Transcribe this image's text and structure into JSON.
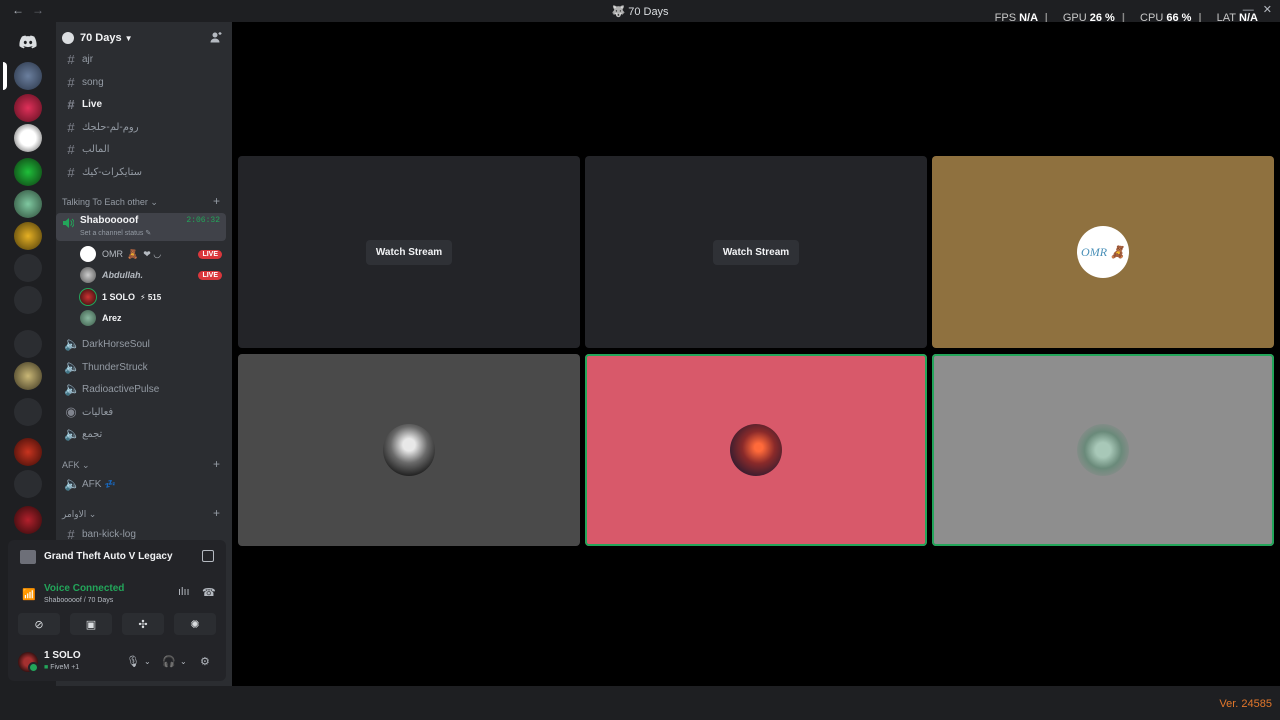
{
  "window": {
    "title": "70 Days"
  },
  "overlay": {
    "fps_label": "FPS",
    "fps_value": "N/A",
    "gpu_label": "GPU",
    "gpu_value": "26 %",
    "cpu_label": "CPU",
    "cpu_value": "66 %",
    "lat_label": "LAT",
    "lat_value": "N/A"
  },
  "guild": {
    "name": "70 Days"
  },
  "channels": {
    "text": [
      {
        "label": "ajr"
      },
      {
        "label": "song"
      },
      {
        "label": "Live"
      },
      {
        "label": "روم-لم-حلجك"
      },
      {
        "label": "المالب"
      },
      {
        "label": "ستايكرات-كيك"
      }
    ],
    "category_talking": "Talking To Each other",
    "voice_active": {
      "name": "Shabooooof",
      "status": "Set a channel status",
      "timer": "2:06:32"
    },
    "members": [
      {
        "name": "OMR",
        "live": "LIVE",
        "color": "#b5bac1"
      },
      {
        "name": "Abdullah.",
        "live": "LIVE",
        "color": "#b5bac1"
      },
      {
        "name": "1 SOLO",
        "extra": "⚡ 515",
        "color": "#f2f3f5"
      },
      {
        "name": "Arez",
        "color": "#f2f3f5"
      }
    ],
    "voice_other": [
      {
        "label": "DarkHorseSoul"
      },
      {
        "label": "ThunderStruck"
      },
      {
        "label": "RadioactivePulse"
      },
      {
        "label": "فعاليات"
      },
      {
        "label": "تجمع"
      }
    ],
    "category_afk": "AFK",
    "afk_channel": "AFK",
    "category_admin": "الاوامر",
    "ban_channel": "ban-kick-log"
  },
  "game": {
    "name": "Grand Theft Auto V Legacy"
  },
  "voice_status": {
    "label": "Voice Connected",
    "sub": "Shabooooof / 70 Days"
  },
  "user": {
    "name": "1 SOLO",
    "status": "FiveM +1"
  },
  "tiles": {
    "watch_label": "Watch Stream",
    "omr_label": "OMR 🧸"
  },
  "colors": {
    "accent_green": "#23a55a",
    "live_red": "#da373c",
    "tile_gold": "#8f713f",
    "tile_red": "#d8596a",
    "tile_gray": "#8e8e8e",
    "tile_darkgray": "#4a4a4a"
  },
  "footer": {
    "version": "Ver. 24585"
  }
}
